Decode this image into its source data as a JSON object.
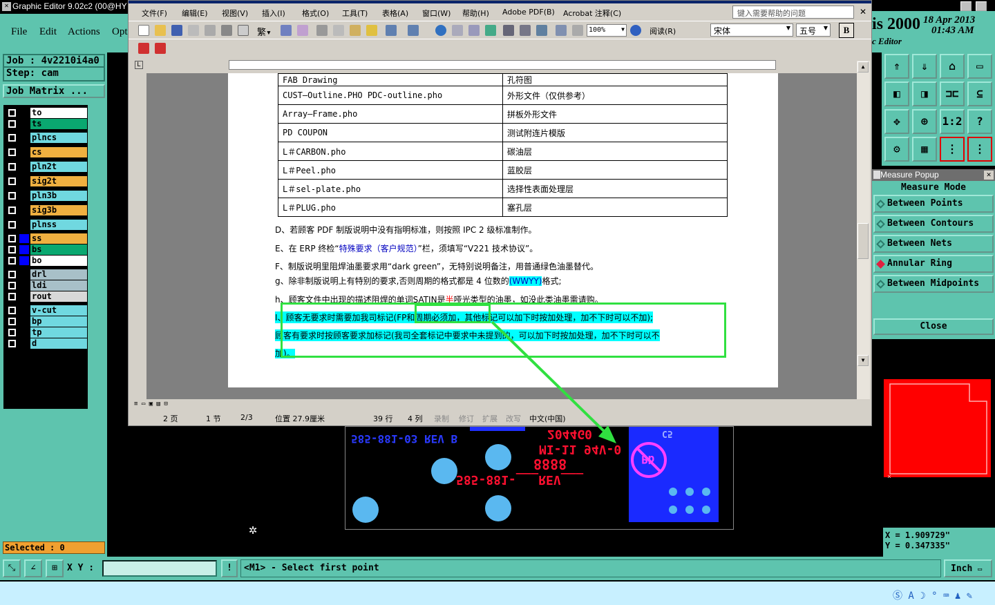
{
  "genesis": {
    "title": "Graphic Editor 9.02c2 (00@HY",
    "menu": [
      "File",
      "Edit",
      "Actions",
      "Opt"
    ],
    "job": "Job : 4v2210i4a0",
    "step": "Step: cam",
    "job_matrix": "Job Matrix ...",
    "layers": [
      {
        "name": "to",
        "color": "#ffffff"
      },
      {
        "name": "ts",
        "color": "#0aa870"
      },
      {
        "name": "plncs",
        "color": "#70d8e0"
      },
      {
        "name": "cs",
        "color": "#f0b040"
      },
      {
        "name": "pln2t",
        "color": "#70d8e0"
      },
      {
        "name": "sig2t",
        "color": "#f0b040"
      },
      {
        "name": "pln3b",
        "color": "#70d8e0"
      },
      {
        "name": "sig3b",
        "color": "#f0b040"
      },
      {
        "name": "plnss",
        "color": "#70d8e0"
      },
      {
        "name": "ss",
        "color": "#f0b040"
      },
      {
        "name": "bs",
        "color": "#0aa870"
      },
      {
        "name": "bo",
        "color": "#ffffff"
      },
      {
        "name": "drl",
        "color": "#a8c0c8"
      },
      {
        "name": "ldi",
        "color": "#a8c0c8"
      },
      {
        "name": "rout",
        "color": "#d8d8d8"
      },
      {
        "name": "v-cut",
        "color": "#70d8e0"
      },
      {
        "name": "bp",
        "color": "#70d8e0"
      },
      {
        "name": "tp",
        "color": "#70d8e0"
      },
      {
        "name": "d",
        "color": "#70d8e0"
      }
    ],
    "selected": "Selected : 0",
    "brand": "is 2000",
    "date": "18 Apr 2013",
    "time": "01:43 AM",
    "subtitle": "c Editor",
    "xy_label": "X Y :",
    "prompt": "<M1> - Select first point",
    "units": "Inch",
    "coord_x": "X = 1.909729\"",
    "coord_y": "Y = 0.347335\""
  },
  "measure": {
    "title": "Measure Popup",
    "mode_label": "Measure Mode",
    "options": [
      "Between Points",
      "Between Contours",
      "Between Nets",
      "Annular Ring",
      "Between Midpoints"
    ],
    "selected": "Annular Ring",
    "close": "Close"
  },
  "word": {
    "menu": [
      "文件(F)",
      "编辑(E)",
      "视图(V)",
      "插入(I)",
      "格式(O)",
      "工具(T)",
      "表格(A)",
      "窗口(W)",
      "帮助(H)",
      "Adobe PDF(B)",
      "Acrobat 注释(C)"
    ],
    "help_placeholder": "键入需要帮助的问题",
    "zoom": "100%",
    "read_label": "阅读(R)",
    "font": "宋体",
    "size": "五号",
    "bold": "B",
    "table_rows": [
      [
        "FAB Drawing",
        "孔符图"
      ],
      [
        "CUST—Outline.PHO   PDC-outline.pho",
        "外形文件（仅供参考）"
      ],
      [
        "Array—Frame.pho",
        "拼板外形文件"
      ],
      [
        "PD COUPON",
        "测试附连片模版"
      ],
      [
        "L＃CARBON.pho",
        "碳油层"
      ],
      [
        "L＃Peel.pho",
        "蓝胶层"
      ],
      [
        "L＃sel-plate.pho",
        "选择性表面处理层"
      ],
      [
        "L＃PLUG.pho",
        "塞孔层"
      ]
    ],
    "para_d": "D、若顾客 PDF 制版说明中没有指明标准，则按照 IPC 2 级标准制作。",
    "para_e1": "E、在 ERP 终检“",
    "para_e2": "特殊要求（客户规范）",
    "para_e3": "”栏，须填写“V221 技术协议”。",
    "para_f": "F、制版说明里阻焊油墨要求用“dark green”，无特别说明备注，用普通绿色油墨替代。",
    "para_g1": "g、除非制版说明上有特别的要求,否则周期的格式都是 4 位数的",
    "para_g2": "(WWYY)",
    "para_g3": "格式;",
    "para_h1": "h、顾客文件中出现的描述阻焊的单词SATIN是",
    "para_h2": "半",
    "para_h3": "哑光类型的油墨，如没此类油墨需请购。",
    "para_i1": "I、顾客无要求时需要加我司标记(FP和周期必须加，其他标记可以加下时按加处理，加不下时可以不加);",
    "para_i2": "顾客有要求时按顾客要求加标记(我司全套标记中要求中未提到的，可以加下时按加处理，加不下时可以不",
    "para_i3": "加)。",
    "status": [
      "2 页",
      "1 节",
      "2/3",
      "位置 27.9厘米",
      "39 行",
      "4 列",
      "录制",
      "修订",
      "扩展",
      "改写",
      "中文(中国)"
    ]
  },
  "cam": {
    "left_text": "585-881-03 REV B",
    "lot": "2044G0",
    "ul": "MI-11 94V-0",
    "date_code": "8888",
    "rev_text": "585-881-___REV___",
    "cs_label": "C5",
    "pb_label": "Pb"
  }
}
